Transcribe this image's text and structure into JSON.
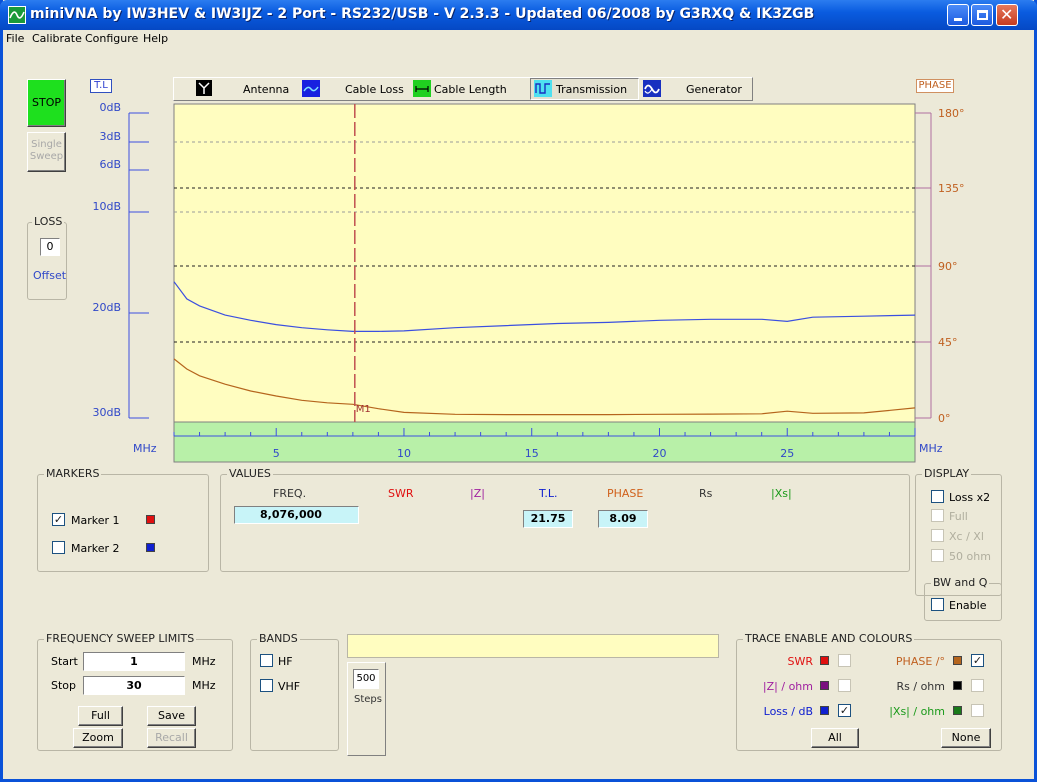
{
  "window": {
    "title": "miniVNA by IW3HEV & IW3IJZ - 2 Port - RS232/USB - V 2.3.3 - Updated 06/2008 by G3RXQ & IK3ZGB"
  },
  "menu": [
    "File",
    "Calibrate",
    "Configure",
    "Help"
  ],
  "left": {
    "stop_label": "STOP",
    "single_sweep_label": "Single Sweep",
    "tl_label": "T.L",
    "loss_group": "LOSS",
    "loss_value": "0",
    "offset_label": "Offset"
  },
  "tabs": [
    {
      "label": "Antenna"
    },
    {
      "label": "Cable Loss"
    },
    {
      "label": "Cable Length"
    },
    {
      "label": "Transmission"
    },
    {
      "label": "Generator"
    }
  ],
  "phase_label": "PHASE",
  "chart": {
    "left_ticks": [
      "0dB",
      "3dB",
      "6dB",
      "10dB",
      "20dB",
      "30dB"
    ],
    "right_ticks": [
      "180°",
      "135°",
      "90°",
      "45°",
      "0°"
    ],
    "x_ticks": [
      "5",
      "10",
      "15",
      "20",
      "25"
    ],
    "x_unit_left": "MHz",
    "x_unit_right": "MHz",
    "marker_label": "M1"
  },
  "chart_data": {
    "type": "line",
    "xlim": [
      1,
      30
    ],
    "x_unit": "MHz",
    "series": [
      {
        "name": "Loss / dB",
        "color": "#3b4fe0",
        "x": [
          1,
          1.5,
          2,
          3,
          4,
          5,
          6,
          7,
          8,
          9,
          10,
          12,
          14,
          16,
          18,
          20,
          22,
          24,
          25,
          26,
          28,
          30
        ],
        "y": [
          16.9,
          18.6,
          19.3,
          20.2,
          20.7,
          21.1,
          21.4,
          21.6,
          21.75,
          21.75,
          21.7,
          21.4,
          21.2,
          21.0,
          20.9,
          20.7,
          20.6,
          20.6,
          20.8,
          20.4,
          20.3,
          20.2
        ]
      },
      {
        "name": "PHASE /°",
        "color": "#b5651d",
        "x": [
          1,
          1.5,
          2,
          3,
          4,
          5,
          6,
          7,
          8,
          9,
          10,
          12,
          14,
          16,
          18,
          20,
          22,
          24,
          25,
          26,
          28,
          30
        ],
        "y": [
          35.0,
          29.0,
          25.0,
          20.0,
          16.0,
          13.0,
          10.5,
          9.0,
          8.09,
          5.5,
          3.3,
          2.2,
          2.0,
          2.0,
          2.0,
          2.2,
          2.3,
          2.5,
          4.0,
          2.8,
          3.0,
          6.0
        ]
      }
    ],
    "marker": {
      "name": "M1",
      "x": 8.076
    }
  },
  "markers": {
    "group": "MARKERS",
    "m1": "Marker 1",
    "m2": "Marker 2",
    "m1_checked": true,
    "m2_checked": false
  },
  "values": {
    "group": "VALUES",
    "headers": {
      "freq": "FREQ.",
      "swr": "SWR",
      "z": "|Z|",
      "tl": "T.L.",
      "phase": "PHASE",
      "rs": "Rs",
      "xs": "|Xs|"
    },
    "freq": "8,076,000",
    "tl": "21.75",
    "phase": "8.09"
  },
  "display": {
    "group": "DISPLAY",
    "loss_x2": "Loss x2",
    "full": "Full",
    "xc_xl": "Xc / Xl",
    "ohm50": "50 ohm"
  },
  "bwq": {
    "group": "BW and Q",
    "enable": "Enable"
  },
  "sweep": {
    "group": "FREQUENCY SWEEP LIMITS",
    "start_label": "Start",
    "start": "1",
    "stop_label": "Stop",
    "stop": "30",
    "unit": "MHz",
    "full": "Full",
    "save": "Save",
    "zoom": "Zoom",
    "recall": "Recall"
  },
  "bands": {
    "group": "BANDS",
    "hf": "HF",
    "vhf": "VHF"
  },
  "steps": {
    "value": "500",
    "label": "Steps"
  },
  "trace": {
    "group": "TRACE ENABLE AND COLOURS",
    "swr": "SWR",
    "phase": "PHASE /°",
    "z": "|Z| / ohm",
    "rs": "Rs / ohm",
    "loss": "Loss / dB",
    "xs": "|Xs| / ohm",
    "all": "All",
    "none": "None"
  },
  "colors": {
    "swr": "#e01010",
    "phase": "#b5651d",
    "z": "#7a1080",
    "rs": "#000000",
    "loss": "#1020d0",
    "xs": "#1a7a1a",
    "chart_bg": "#fffdc0",
    "axis_bg": "#b8f0a8",
    "marker": "#c05050"
  }
}
